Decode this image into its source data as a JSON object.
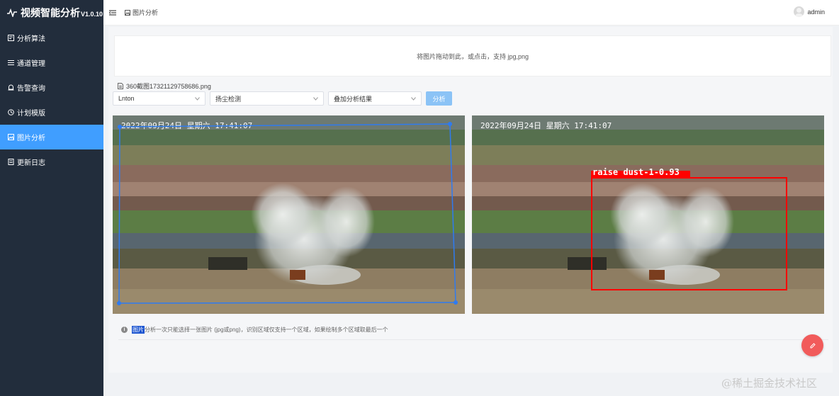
{
  "app": {
    "title": "视频智能分析",
    "version": "V1.0.10"
  },
  "sidebar": {
    "items": [
      {
        "label": "分析算法",
        "icon": "algorithm-icon",
        "active": false
      },
      {
        "label": "通道管理",
        "icon": "list-icon",
        "active": false
      },
      {
        "label": "告警查询",
        "icon": "alarm-icon",
        "active": false
      },
      {
        "label": "计划模版",
        "icon": "clock-icon",
        "active": false
      },
      {
        "label": "图片分析",
        "icon": "image-icon",
        "active": true
      },
      {
        "label": "更新日志",
        "icon": "document-icon",
        "active": false
      }
    ]
  },
  "header": {
    "breadcrumb": "图片分析",
    "user": "admin"
  },
  "upload": {
    "text": "将图片拖动到此，或点击，支持 jpg,png"
  },
  "file": {
    "name": "360截图17321129758686.png"
  },
  "controls": {
    "channel_select": "Lnton",
    "algorithm_select": "扬尘检测",
    "mode_select": "叠加分析结果",
    "analyze_button": "分析"
  },
  "images": {
    "timestamp": "2022年09月24日  星期六  17:41:07",
    "detection_label": "raise dust-1-0.93"
  },
  "hint": {
    "highlight": "图片",
    "text": "分析一次只能选择一张图片 (jpg或png)，识别区域仅支持一个区域，如果绘制多个区域取最后一个"
  },
  "watermark": "@稀土掘金技术社区",
  "colors": {
    "sidebar_bg": "#222d3c",
    "accent": "#409eff",
    "button": "#8bc3f6",
    "detection": "#ff0000",
    "fab": "#f15b5b"
  }
}
